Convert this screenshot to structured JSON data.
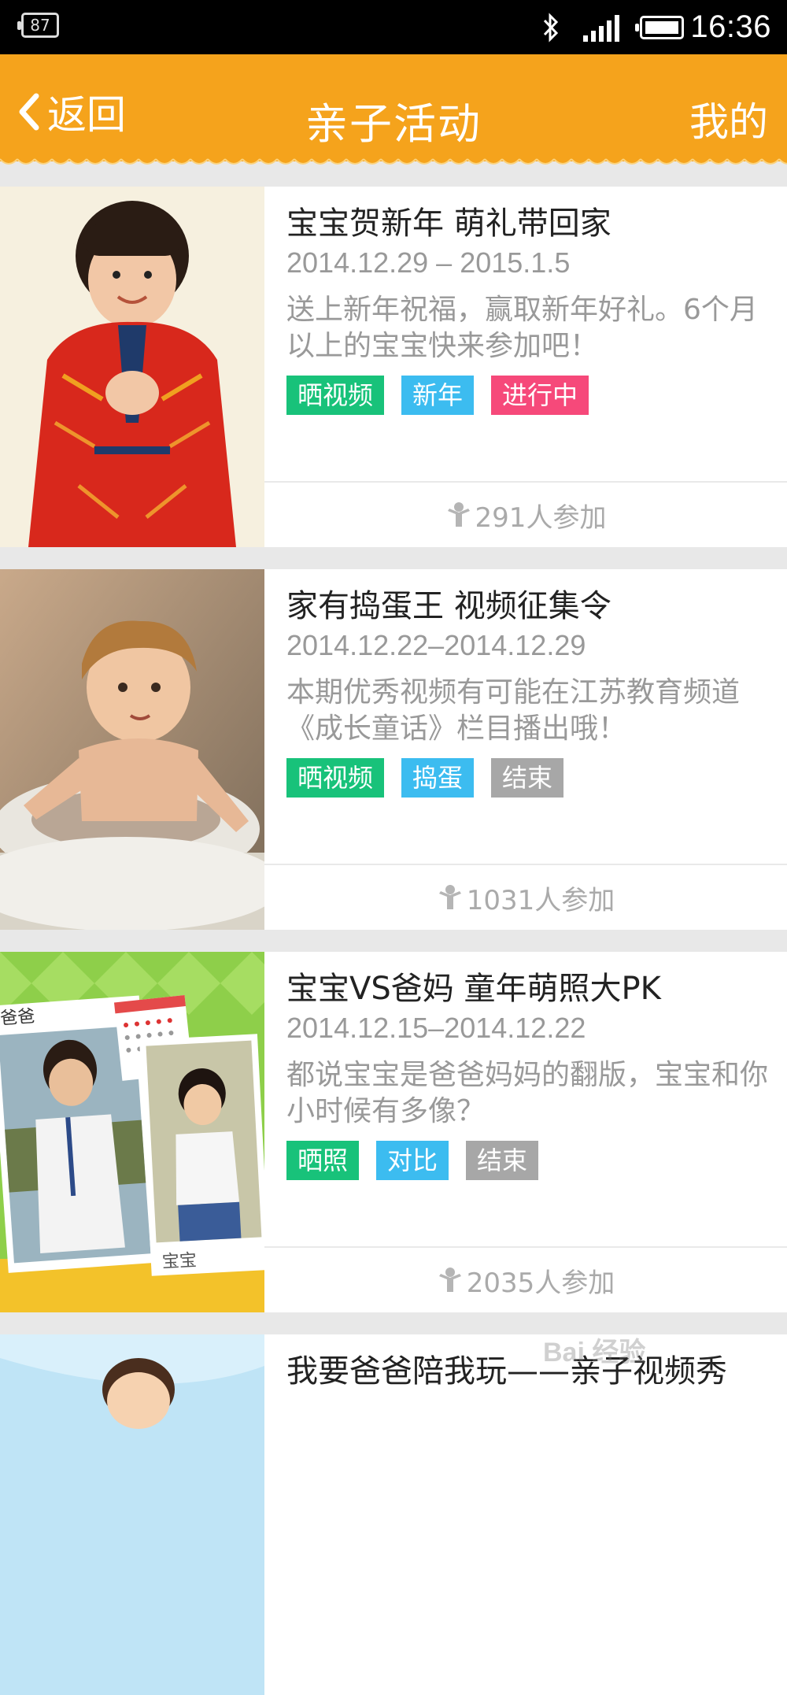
{
  "status_bar": {
    "notification_badge": "87",
    "time": "16:36"
  },
  "header": {
    "back_label": "返回",
    "title": "亲子活动",
    "mine_label": "我的",
    "bg_color": "#f5a31c"
  },
  "activities": [
    {
      "title": "宝宝贺新年 萌礼带回家",
      "date": "2014.12.29 – 2015.1.5",
      "description": "送上新年祝福，赢取新年好礼。6个月以上的宝宝快来参加吧！",
      "tags": [
        {
          "label": "晒视频",
          "color": "#18c27a"
        },
        {
          "label": "新年",
          "color": "#3cbcf0"
        },
        {
          "label": "进行中",
          "color": "#f6497a"
        }
      ],
      "participants": "291人参加"
    },
    {
      "title": "家有捣蛋王 视频征集令",
      "date": "2014.12.22–2014.12.29",
      "description": "本期优秀视频有可能在江苏教育频道《成长童话》栏目播出哦！",
      "tags": [
        {
          "label": "晒视频",
          "color": "#18c27a"
        },
        {
          "label": "捣蛋",
          "color": "#3cbcf0"
        },
        {
          "label": "结束",
          "color": "#a7a7a7"
        }
      ],
      "participants": "1031人参加"
    },
    {
      "title": "宝宝VS爸妈 童年萌照大PK",
      "date": "2014.12.15–2014.12.22",
      "description": "都说宝宝是爸爸妈妈的翻版，宝宝和你小时候有多像？",
      "tags": [
        {
          "label": "晒照",
          "color": "#18c27a"
        },
        {
          "label": "对比",
          "color": "#3cbcf0"
        },
        {
          "label": "结束",
          "color": "#a7a7a7"
        }
      ],
      "participants": "2035人参加"
    },
    {
      "title": "我要爸爸陪我玩——亲子视频秀"
    }
  ],
  "photo_labels": {
    "dad": "爸爸",
    "baby": "宝宝"
  },
  "watermark": "Bai 经验"
}
